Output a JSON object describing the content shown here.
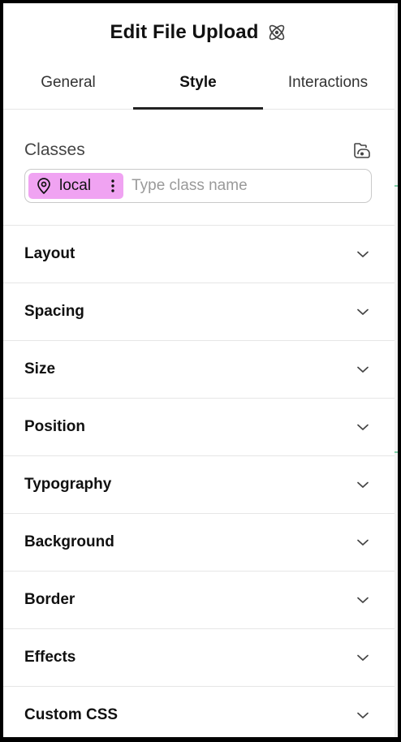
{
  "header": {
    "title": "Edit File Upload",
    "icon": "atom-icon"
  },
  "tabs": [
    {
      "label": "General",
      "active": false
    },
    {
      "label": "Style",
      "active": true
    },
    {
      "label": "Interactions",
      "active": false
    }
  ],
  "classes": {
    "label": "Classes",
    "chip_label": "local",
    "input_placeholder": "Type class name"
  },
  "sections": [
    {
      "label": "Layout"
    },
    {
      "label": "Spacing"
    },
    {
      "label": "Size"
    },
    {
      "label": "Position"
    },
    {
      "label": "Typography"
    },
    {
      "label": "Background"
    },
    {
      "label": "Border"
    },
    {
      "label": "Effects"
    },
    {
      "label": "Custom CSS"
    }
  ],
  "colors": {
    "chip_bg": "#f0a3f2",
    "active_tab_underline": "#222222"
  }
}
